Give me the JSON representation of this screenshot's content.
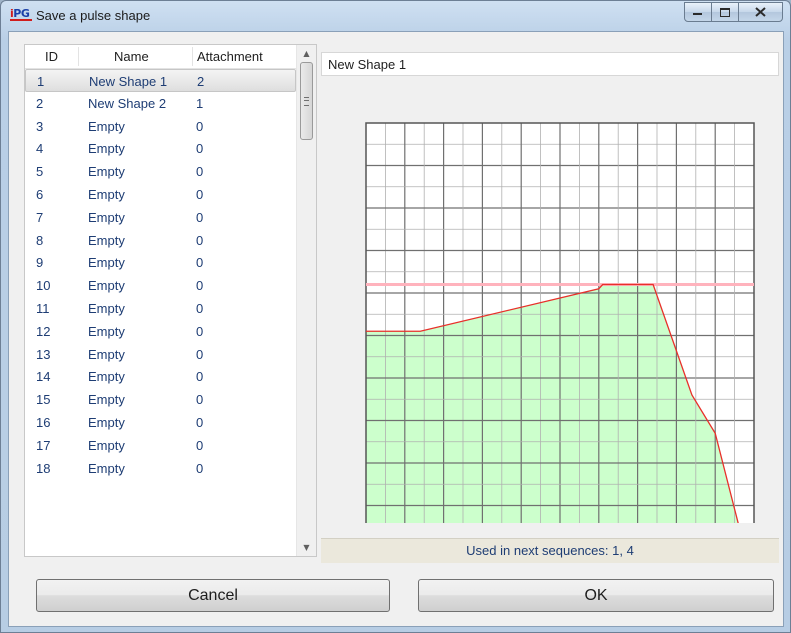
{
  "window": {
    "title": "Save a pulse shape",
    "icon_text": "IPG"
  },
  "table": {
    "headers": {
      "id": "ID",
      "name": "Name",
      "attachment": "Attachment"
    },
    "selected_index": 0,
    "rows": [
      {
        "id": "1",
        "name": "New Shape 1",
        "attachment": "2"
      },
      {
        "id": "2",
        "name": "New Shape 2",
        "attachment": "1"
      },
      {
        "id": "3",
        "name": "Empty",
        "attachment": "0"
      },
      {
        "id": "4",
        "name": "Empty",
        "attachment": "0"
      },
      {
        "id": "5",
        "name": "Empty",
        "attachment": "0"
      },
      {
        "id": "6",
        "name": "Empty",
        "attachment": "0"
      },
      {
        "id": "7",
        "name": "Empty",
        "attachment": "0"
      },
      {
        "id": "8",
        "name": "Empty",
        "attachment": "0"
      },
      {
        "id": "9",
        "name": "Empty",
        "attachment": "0"
      },
      {
        "id": "10",
        "name": "Empty",
        "attachment": "0"
      },
      {
        "id": "11",
        "name": "Empty",
        "attachment": "0"
      },
      {
        "id": "12",
        "name": "Empty",
        "attachment": "0"
      },
      {
        "id": "13",
        "name": "Empty",
        "attachment": "0"
      },
      {
        "id": "14",
        "name": "Empty",
        "attachment": "0"
      },
      {
        "id": "15",
        "name": "Empty",
        "attachment": "0"
      },
      {
        "id": "16",
        "name": "Empty",
        "attachment": "0"
      },
      {
        "id": "17",
        "name": "Empty",
        "attachment": "0"
      },
      {
        "id": "18",
        "name": "Empty",
        "attachment": "0"
      }
    ]
  },
  "shape_name": "New Shape 1",
  "status_text": "Used in next sequences: 1, 4",
  "buttons": {
    "cancel": "Cancel",
    "ok": "OK"
  },
  "colors": {
    "fill": "#ccffcc",
    "line": "#e8302a",
    "reference_line": "#ffb3bd",
    "grid_major": "#707070",
    "grid_minor": "#b0b0b0"
  },
  "chart_data": {
    "type": "area",
    "x": [
      0,
      14,
      60,
      61,
      74,
      84,
      90,
      97,
      100
    ],
    "values": [
      51,
      51,
      61,
      62,
      62,
      36,
      27,
      2,
      0
    ],
    "reference_line": 62,
    "xlim": [
      0,
      100
    ],
    "ylim": [
      0,
      100
    ],
    "grid": true,
    "title": "",
    "xlabel": "",
    "ylabel": ""
  }
}
